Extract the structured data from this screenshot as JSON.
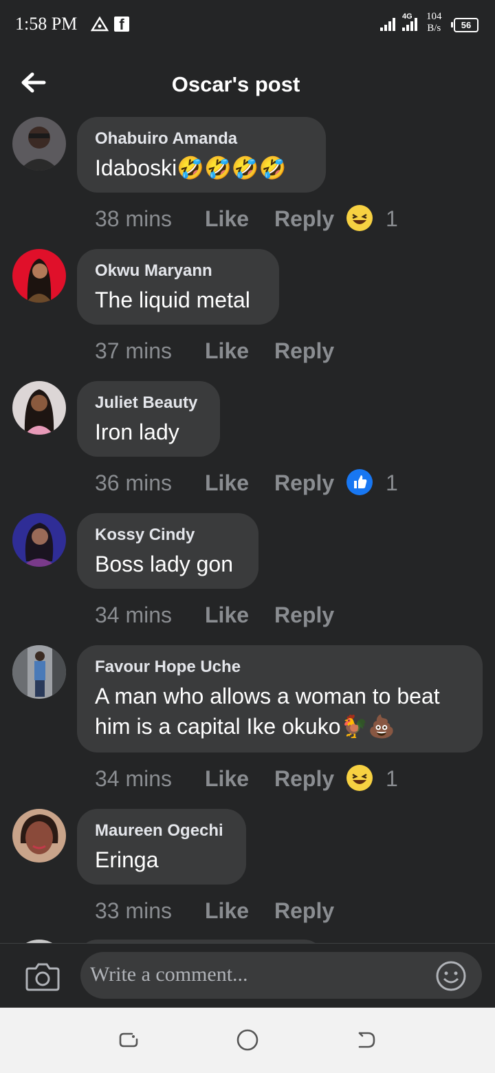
{
  "status_bar": {
    "time": "1:58 PM",
    "network": "4G",
    "speed_value": "104",
    "speed_unit": "B/s",
    "battery": "56"
  },
  "header": {
    "title": "Oscar's post"
  },
  "comments": [
    {
      "author": "Ohabuiro Amanda",
      "text": "Idaboski🤣🤣🤣🤣",
      "time": "38 mins",
      "like": "Like",
      "reply": "Reply",
      "reaction": "haha",
      "reaction_count": "1",
      "avatar_color": "#4a3b36"
    },
    {
      "author": "Okwu Maryann",
      "text": "The liquid metal",
      "time": "37 mins",
      "like": "Like",
      "reply": "Reply",
      "avatar_color": "#e0102a"
    },
    {
      "author": "Juliet Beauty",
      "text": "Iron lady",
      "time": "36 mins",
      "like": "Like",
      "reply": "Reply",
      "reaction": "like",
      "reaction_count": "1",
      "avatar_color": "#d8cfcf"
    },
    {
      "author": "Kossy Cindy",
      "text": "Boss lady gon",
      "time": "34 mins",
      "like": "Like",
      "reply": "Reply",
      "avatar_color": "#2b2a8a"
    },
    {
      "author": "Favour Hope Uche",
      "text": "A man who allows a woman to beat\nhim is a capital Ike okuko🐓💩",
      "time": "34 mins",
      "like": "Like",
      "reply": "Reply",
      "reaction": "haha",
      "reaction_count": "1",
      "avatar_color": "#8b8e93"
    },
    {
      "author": "Maureen Ogechi",
      "text": "Eringa",
      "time": "33 mins",
      "like": "Like",
      "reply": "Reply",
      "avatar_color": "#b46a55"
    }
  ],
  "composer": {
    "placeholder": "Write a comment..."
  },
  "colors": {
    "background": "#242526",
    "bubble": "#3a3b3c",
    "meta_text": "#8a8d91",
    "like_reaction": "#1877f2",
    "haha_reaction": "#f7d142"
  }
}
